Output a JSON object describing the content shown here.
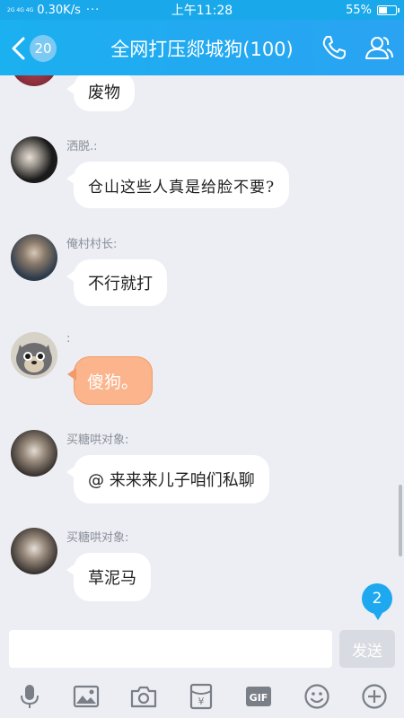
{
  "status_bar": {
    "signal": "2G 4G 4G",
    "speed": "0.30K/s",
    "dots": "···",
    "time": "上午11:28",
    "battery": "55%",
    "battery_level": 0.55
  },
  "header": {
    "unread_count": "20",
    "title": "全网打压郯城狗(100)",
    "icons": [
      "back-icon",
      "phone-icon",
      "group-members-icon"
    ]
  },
  "messages": [
    {
      "sender": "",
      "text": "废物",
      "style": "normal"
    },
    {
      "sender": "洒脱.:",
      "text": "仓山这些人真是给脸不要?",
      "style": "hand"
    },
    {
      "sender": "俺村村长:",
      "text": "不行就打",
      "style": "normal"
    },
    {
      "sender": ":",
      "text": "傻狗。",
      "style": "orange"
    },
    {
      "sender": "买糖哄对象:",
      "text": "@ 来来来儿子咱们私聊",
      "style": "normal"
    },
    {
      "sender": "买糖哄对象:",
      "text": "草泥马",
      "style": "normal"
    }
  ],
  "new_message_badge": "2",
  "input": {
    "value": "",
    "placeholder": "",
    "send_label": "发送"
  },
  "toolbar": {
    "items": [
      "microphone-icon",
      "image-icon",
      "camera-icon",
      "red-packet-icon",
      "gif-icon",
      "emoji-icon",
      "plus-icon"
    ],
    "gif_label": "GIF",
    "yen_label": "¥"
  },
  "colors": {
    "header": "#19a8ea",
    "background": "#eceef3",
    "orange_bubble": "#fbb48c",
    "accent": "#1ea8ef"
  }
}
